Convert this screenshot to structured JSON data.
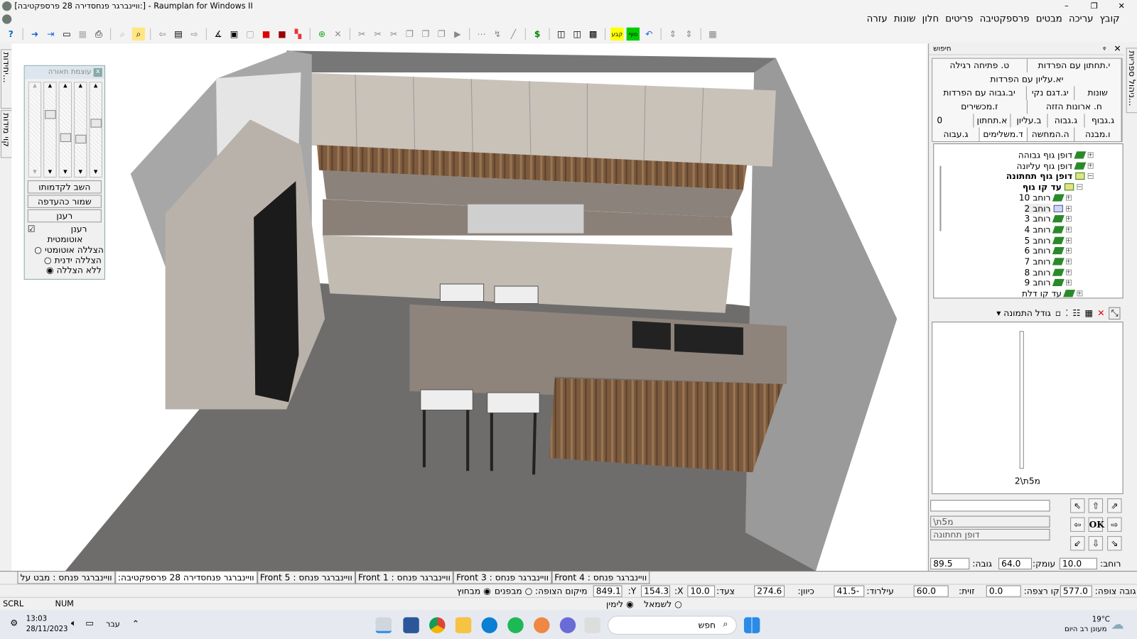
{
  "window": {
    "title": "[וויינברגר פנחסדירה 28 פרספקטיבה:] - Raumplan for Windows II",
    "minimize": "–",
    "restore": "❐",
    "close": "✕"
  },
  "menu": [
    "קובץ",
    "עריכה",
    "מבטים",
    "פרספקטיבה",
    "פריטים",
    "חלון",
    "שונות",
    "עזרה"
  ],
  "left_tabs": [
    "רשימת יחידות...",
    "קוי מידות"
  ],
  "lighting": {
    "title": "עוצמת תאורה",
    "close": "x",
    "buttons": [
      "השב לקדמותו",
      "שמור כהעדפה",
      "רענן"
    ],
    "auto_refresh": "רענן",
    "auto_refresh2": "אוטומטית",
    "options": [
      "הצללה אוטומטי",
      "הצללה ידנית",
      "ללא הצללה"
    ],
    "selected": 2,
    "sliders": [
      0.5,
      0.55,
      0.52,
      0.2,
      0.3
    ]
  },
  "right_tab": "ניהול ספריות...",
  "panel": {
    "search": "חיפוש",
    "pin": "ᵩ",
    "close": "✕",
    "tab_rows": [
      [
        "י.תחתון עם הפרדות",
        "ט. פתיחה רגילה"
      ],
      [
        "יא.עליון עם הפרדות"
      ],
      [
        "שונות",
        "יג.דגם נקי",
        "יב.גבוה עם הפרדות"
      ],
      [
        "ח. ארונות הזזה",
        "ז.מכשירים"
      ],
      [
        "ג.גבוף",
        "ג.גבוה",
        "ב.עליון",
        "א.תחתון",
        "0"
      ],
      [
        "ו.מבנה",
        "ה.המחשה",
        "ד.משלימים",
        "ג.עבוה"
      ]
    ],
    "tree": [
      {
        "label": "דופן גוף גבוהה",
        "level": 0,
        "bold": false
      },
      {
        "label": "דופן גוף עליונה",
        "level": 0,
        "bold": false
      },
      {
        "label": "דופן גוף תחתונה",
        "level": 0,
        "bold": true
      },
      {
        "label": "עד קו גוף",
        "level": 1,
        "bold": true
      },
      {
        "label": "רוחב 10",
        "level": 2
      },
      {
        "label": "רוחב 2",
        "level": 2,
        "selected": true
      },
      {
        "label": "רוחב 3",
        "level": 2
      },
      {
        "label": "רוחב 4",
        "level": 2
      },
      {
        "label": "רוחב 5",
        "level": 2
      },
      {
        "label": "רוחב 6",
        "level": 2
      },
      {
        "label": "רוחב 7",
        "level": 2
      },
      {
        "label": "רוחב 8",
        "level": 2
      },
      {
        "label": "רוחב 9",
        "level": 2
      },
      {
        "label": "עד קו דלת",
        "level": 1
      }
    ],
    "preview_size": "גודל התמונה",
    "preview_label": "מ5ת\\2",
    "ok": "OK",
    "code": "\\מ5ת",
    "desc": "דופן תחתונה",
    "dims": {
      "width_label": "רוחב:",
      "width": "10.0",
      "depth_label": "עומק:",
      "depth": "64.0",
      "height_label": "גובה:",
      "height": "89.5"
    }
  },
  "doc_tabs": [
    "וויינברגר פנחס : Front 4",
    "וויינברגר פנחס : Front 3",
    "וויינברגר פנחס : Front 1",
    "וויינברגר פנחס : Front 5",
    "וויינברגר פנחסדירה 28 פרספקטיבה:",
    "וויינברגר פנחס : מבט על"
  ],
  "status": {
    "eye_h_label": "גובה צופה:",
    "eye_h": "577.0",
    "floor_label": "קו רצפה:",
    "floor": "0.0",
    "angle_label": "זוית:",
    "angle": "60.0",
    "tilt_label": "עילרוד:",
    "tilt": "41.5-",
    "dir_label": "כיוון:",
    "dir": "274.6",
    "step_label": "צעד:",
    "step": "10.0",
    "x_label": "X:",
    "x": "154.3",
    "y_label": "Y:",
    "y": "849.1",
    "pos_label": "מיקום הצופה:",
    "inside": "מבפנים",
    "outside": "מבחוץ",
    "left": "לשמאל",
    "right": "לימין"
  },
  "indicators": [
    "SCRL",
    "NUM"
  ],
  "taskbar": {
    "time": "13:03",
    "date": "28/11/2023",
    "lang": "עבר",
    "search": "חפש",
    "weather": "19°C",
    "weather_desc": "מעונן רב היום"
  }
}
